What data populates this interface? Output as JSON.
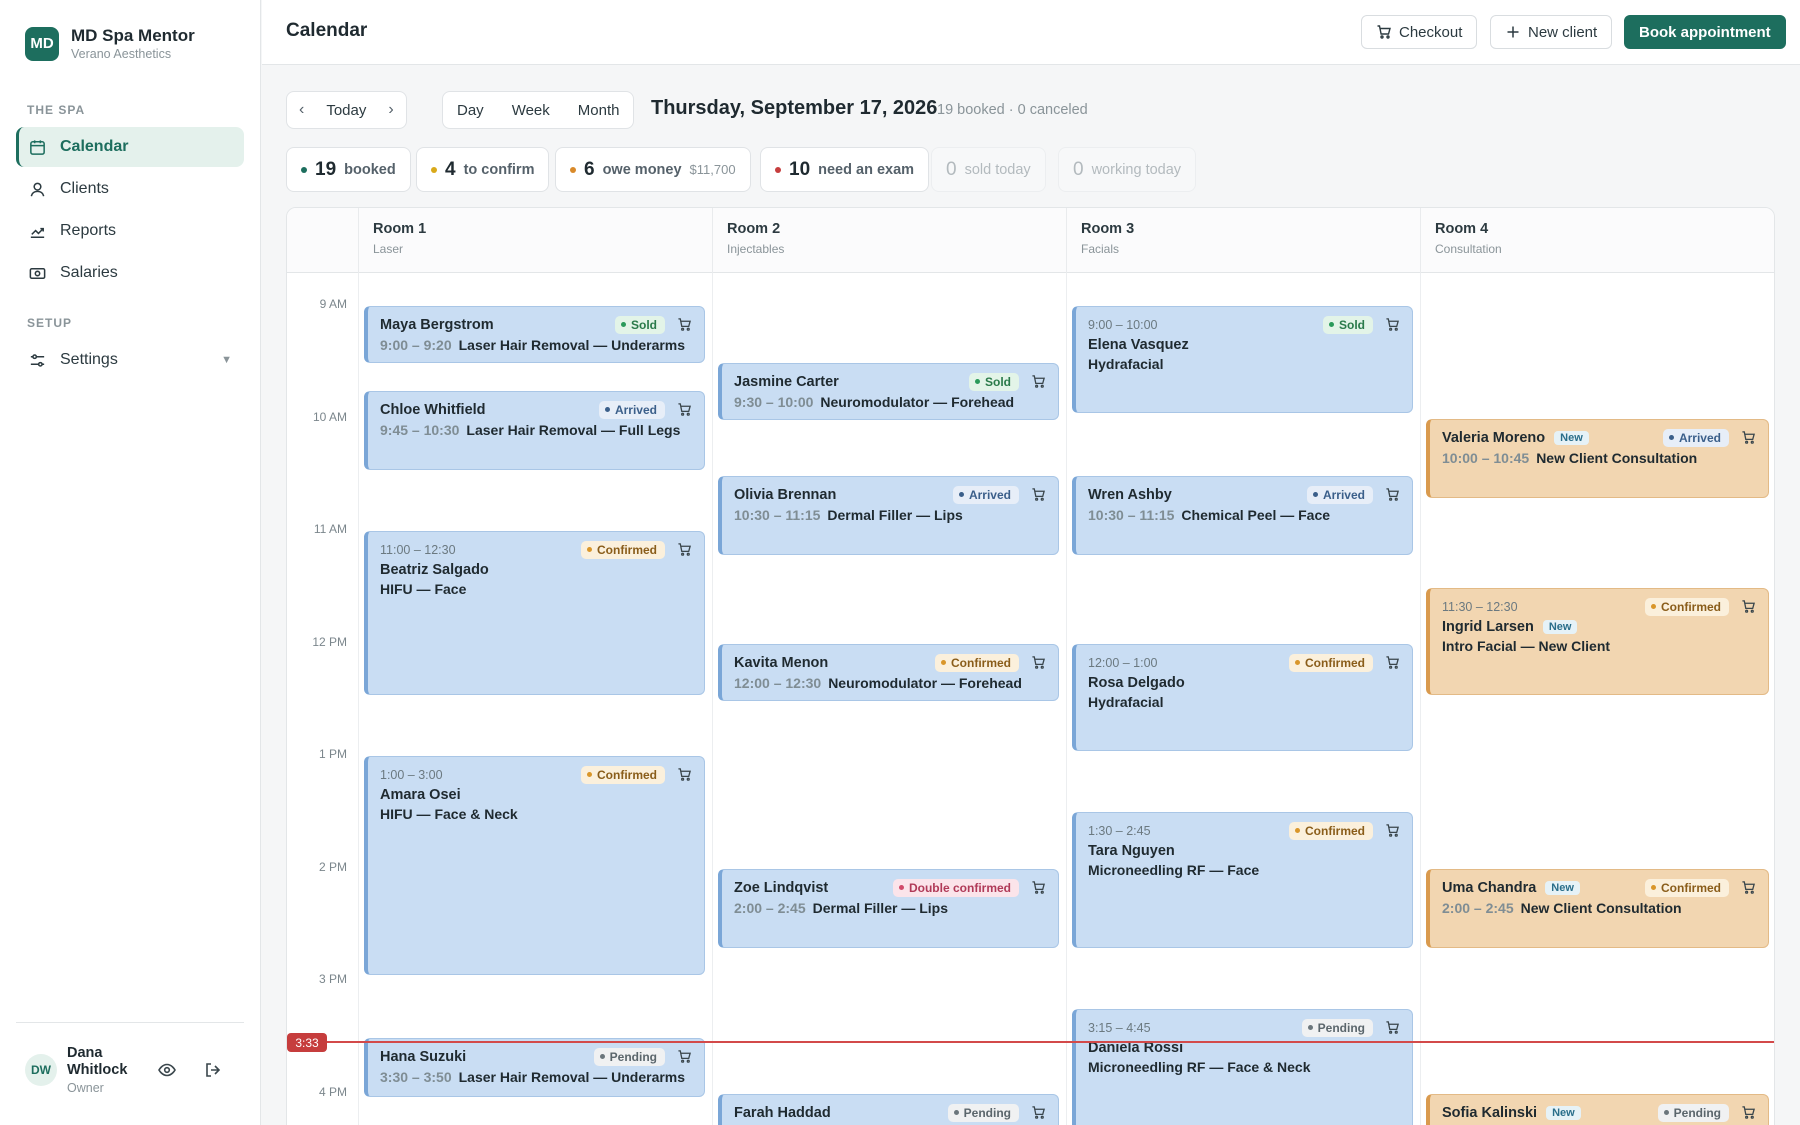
{
  "brand": {
    "logo": "MD",
    "name": "MD Spa Mentor",
    "sub": "Verano Aesthetics"
  },
  "sidebar": {
    "section1": "THE SPA",
    "items": [
      {
        "label": "Calendar",
        "icon": "calendar-icon"
      },
      {
        "label": "Clients",
        "icon": "user-icon"
      },
      {
        "label": "Reports",
        "icon": "chart-icon"
      },
      {
        "label": "Salaries",
        "icon": "cash-icon"
      }
    ],
    "section2": "SETUP",
    "settings": {
      "label": "Settings",
      "icon": "sliders-icon"
    }
  },
  "user": {
    "initials": "DW",
    "name": "Dana Whitlock",
    "role": "Owner"
  },
  "header": {
    "title": "Calendar",
    "checkout": "Checkout",
    "new_client": "New client",
    "book": "Book appointment"
  },
  "toolbar": {
    "today": "Today",
    "day": "Day",
    "week": "Week",
    "month": "Month",
    "date": "Thursday, September 17, 2026",
    "summary": "19 booked · 0 canceled"
  },
  "stats": [
    {
      "num": "19",
      "label": "booked",
      "color": "#1d6e5e"
    },
    {
      "num": "4",
      "label": "to confirm",
      "color": "#d9a91a"
    },
    {
      "num": "6",
      "label": "owe money",
      "extra": "$11,700",
      "color": "#d98a2a"
    },
    {
      "num": "10",
      "label": "need an exam",
      "color": "#c63d3d"
    },
    {
      "num": "0",
      "label": "sold today"
    },
    {
      "num": "0",
      "label": "working today"
    }
  ],
  "rooms": [
    {
      "name": "Room 1",
      "type": "Laser"
    },
    {
      "name": "Room 2",
      "type": "Injectables"
    },
    {
      "name": "Room 3",
      "type": "Facials"
    },
    {
      "name": "Room 4",
      "type": "Consultation"
    }
  ],
  "times": [
    "9 AM",
    "10 AM",
    "11 AM",
    "12 PM",
    "1 PM",
    "2 PM",
    "3 PM",
    "4 PM"
  ],
  "now": "3:33",
  "appts": [
    {
      "name": "Maya Bergstrom",
      "time": "9:00 – 9:20",
      "service": "Laser Hair Removal — Underarms",
      "status": "Sold"
    },
    {
      "name": "Chloe Whitfield",
      "time": "9:45 – 10:30",
      "service": "Laser Hair Removal — Full Legs",
      "status": "Arrived"
    },
    {
      "name": "Beatriz Salgado",
      "time": "11:00 – 12:30",
      "service": "HIFU — Face",
      "status": "Confirmed"
    },
    {
      "name": "Amara Osei",
      "time": "1:00 – 3:00",
      "service": "HIFU — Face & Neck",
      "status": "Confirmed"
    },
    {
      "name": "Hana Suzuki",
      "time": "3:30 – 3:50",
      "service": "Laser Hair Removal — Underarms",
      "status": "Pending"
    },
    {
      "name": "Jasmine Carter",
      "time": "9:30 – 10:00",
      "service": "Neuromodulator — Forehead",
      "status": "Sold"
    },
    {
      "name": "Olivia Brennan",
      "time": "10:30 – 11:15",
      "service": "Dermal Filler — Lips",
      "status": "Arrived"
    },
    {
      "name": "Kavita Menon",
      "time": "12:00 – 12:30",
      "service": "Neuromodulator — Forehead",
      "status": "Confirmed"
    },
    {
      "name": "Zoe Lindqvist",
      "time": "2:00 – 2:45",
      "service": "Dermal Filler — Lips",
      "status": "Double confirmed"
    },
    {
      "name": "Farah Haddad",
      "status": "Pending"
    },
    {
      "name": "Elena Vasquez",
      "time": "9:00 – 10:00",
      "service": "Hydrafacial",
      "status": "Sold"
    },
    {
      "name": "Wren Ashby",
      "time": "10:30 – 11:15",
      "service": "Chemical Peel — Face",
      "status": "Arrived"
    },
    {
      "name": "Rosa Delgado",
      "time": "12:00 – 1:00",
      "service": "Hydrafacial",
      "status": "Confirmed"
    },
    {
      "name": "Tara Nguyen",
      "time": "1:30 – 2:45",
      "service": "Microneedling RF — Face",
      "status": "Confirmed"
    },
    {
      "name": "Daniela Rossi",
      "time": "3:15 – 4:45",
      "service": "Microneedling RF — Face & Neck",
      "status": "Pending"
    },
    {
      "name": "Valeria Moreno",
      "time": "10:00 – 10:45",
      "service": "New Client Consultation",
      "status": "Arrived",
      "tag": "New"
    },
    {
      "name": "Ingrid Larsen",
      "time": "11:30 – 12:30",
      "service": "Intro Facial — New Client",
      "status": "Confirmed",
      "tag": "New"
    },
    {
      "name": "Uma Chandra",
      "time": "2:00 – 2:45",
      "service": "New Client Consultation",
      "status": "Confirmed",
      "tag": "New"
    },
    {
      "name": "Sofia Kalinski",
      "status": "Pending",
      "tag": "New"
    }
  ]
}
